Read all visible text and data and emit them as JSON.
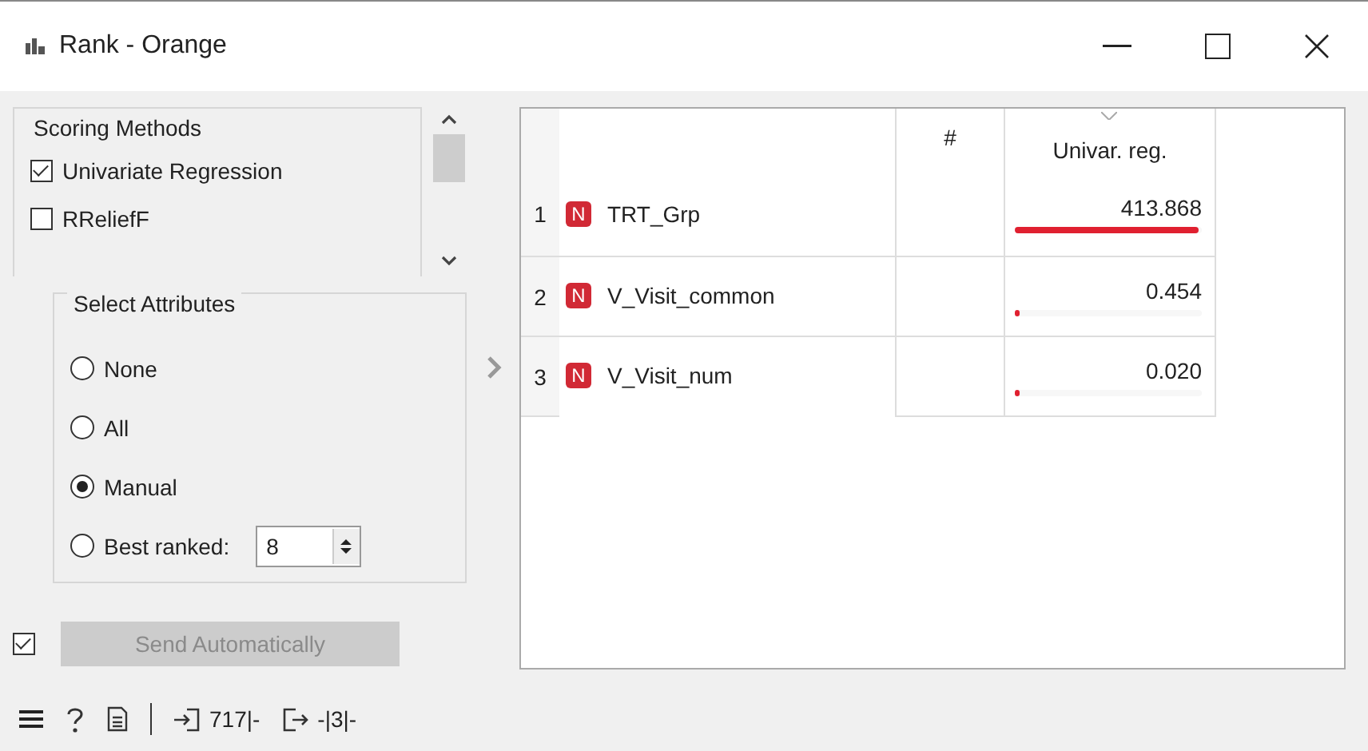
{
  "window": {
    "title": "Rank - Orange"
  },
  "scoring_methods": {
    "title": "Scoring Methods",
    "items": [
      {
        "label": "Univariate Regression",
        "checked": true
      },
      {
        "label": "RReliefF",
        "checked": false
      }
    ]
  },
  "select_attributes": {
    "title": "Select Attributes",
    "options": [
      {
        "label": "None",
        "selected": false
      },
      {
        "label": "All",
        "selected": false
      },
      {
        "label": "Manual",
        "selected": true
      },
      {
        "label": "Best ranked:",
        "selected": false,
        "value": "8"
      }
    ]
  },
  "send": {
    "checked": true,
    "label": "Send Automatically",
    "disabled": true
  },
  "table": {
    "columns": [
      "#",
      "Univar. reg."
    ],
    "rows": [
      {
        "index": "1",
        "type": "N",
        "name": "TRT_Grp",
        "score": "413.868",
        "level": 0.98
      },
      {
        "index": "2",
        "type": "N",
        "name": "V_Visit_common",
        "score": "0.454",
        "level": 0.001
      },
      {
        "index": "3",
        "type": "N",
        "name": "V_Visit_num",
        "score": "0.020",
        "level": 5e-05
      }
    ]
  },
  "status_bar": {
    "input": "717|-",
    "output": "-|3|-"
  }
}
